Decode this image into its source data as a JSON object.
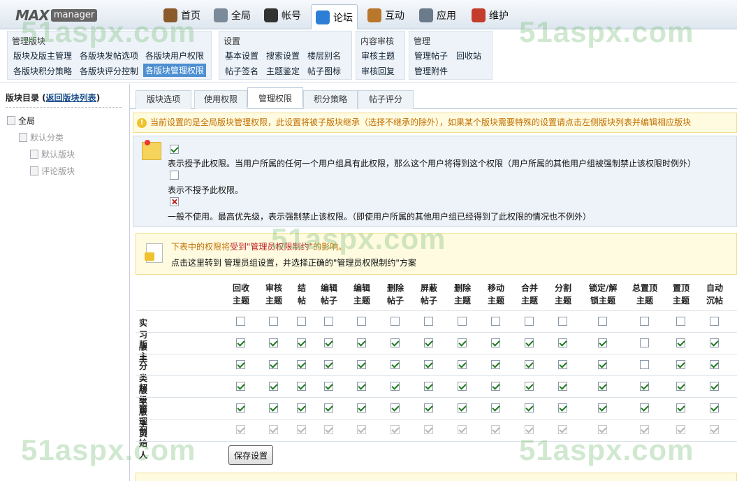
{
  "logo": {
    "max": "MAX",
    "manager": "manager"
  },
  "nav": [
    {
      "label": "首页",
      "icon": "home-icon",
      "color": "#8a5a2b"
    },
    {
      "label": "全局",
      "icon": "gear-icon",
      "color": "#7a8a99"
    },
    {
      "label": "帐号",
      "icon": "user-icon",
      "color": "#333333"
    },
    {
      "label": "论坛",
      "icon": "chat-icon",
      "color": "#2d7fd6"
    },
    {
      "label": "互动",
      "icon": "people-icon",
      "color": "#b9772c"
    },
    {
      "label": "应用",
      "icon": "app-icon",
      "color": "#6b7b8b"
    },
    {
      "label": "维护",
      "icon": "tools-icon",
      "color": "#c33c2c"
    }
  ],
  "submenu": {
    "g1": {
      "title": "管理版块",
      "items": [
        "版块及版主管理",
        "各版块发帖选项",
        "各版块用户权限",
        "各版块积分策略",
        "各版块评分控制",
        "各版块管理权限"
      ]
    },
    "g2": {
      "title": "设置",
      "items": [
        "基本设置",
        "搜索设置",
        "楼层别名",
        "帖子签名",
        "主题鉴定",
        "帖子图标"
      ]
    },
    "g3": {
      "title": "内容审核",
      "items": [
        "审核主题",
        "审核回复"
      ]
    },
    "g4": {
      "title": "管理",
      "items": [
        "管理帖子",
        "回收站",
        "管理附件"
      ]
    }
  },
  "sidebar": {
    "title": "版块目录 (",
    "link": "返回版块列表",
    "close": ")",
    "tree": [
      "全局",
      "默认分类",
      "默认版块",
      "评论版块"
    ]
  },
  "tabs": [
    "版块选项",
    "使用权限",
    "管理权限",
    "积分策略",
    "帖子评分"
  ],
  "warning": "当前设置的是全局版块管理权限，此设置将被子版块继承（选择不继承的除外），如果某个版块需要特殊的设置请点击左侧版块列表并编辑相应版块",
  "legend": {
    "granted": "表示授予此权限。当用户所属的任何一个用户组具有此权限，那么这个用户将得到这个权限（用户所属的其他用户组被强制禁止该权限时例外）",
    "notgranted": "表示不授予此权限。",
    "forbidden": "一般不使用。最高优先级，表示强制禁止该权限。（即使用户所属的其他用户组已经得到了此权限的情况也不例外）"
  },
  "info": {
    "l1a": "下表中的权限将",
    "l1b": "受到\"管理员权限制约\"",
    "l1c": "的影响。",
    "l2": "点击这里转到 管理员组设置，并选择正确的\"管理员权限制约\"方案"
  },
  "columns": [
    [
      "回收",
      "主题"
    ],
    [
      "审核",
      "主题"
    ],
    [
      "结",
      "帖"
    ],
    [
      "编辑",
      "帖子"
    ],
    [
      "编辑",
      "主题"
    ],
    [
      "删除",
      "帖子"
    ],
    [
      "屏蔽",
      "帖子"
    ],
    [
      "删除",
      "主题"
    ],
    [
      "移动",
      "主题"
    ],
    [
      "合并",
      "主题"
    ],
    [
      "分割",
      "主题"
    ],
    [
      "锁定/解",
      "锁主题"
    ],
    [
      "总置顶",
      "主题"
    ],
    [
      "置顶",
      "主题"
    ],
    [
      "自动",
      "沉帖"
    ]
  ],
  "rows": [
    {
      "label": "实习版主",
      "values": [
        0,
        0,
        0,
        0,
        0,
        0,
        0,
        0,
        0,
        0,
        0,
        0,
        0,
        0,
        0
      ],
      "disabled": false
    },
    {
      "label": "版主",
      "values": [
        1,
        1,
        1,
        1,
        1,
        1,
        1,
        1,
        1,
        1,
        1,
        1,
        0,
        1,
        1
      ],
      "disabled": false
    },
    {
      "label": "分类版主",
      "values": [
        1,
        1,
        1,
        1,
        1,
        1,
        1,
        1,
        1,
        1,
        1,
        1,
        0,
        1,
        1
      ],
      "disabled": false
    },
    {
      "label": "超级版主",
      "values": [
        1,
        1,
        1,
        1,
        1,
        1,
        1,
        1,
        1,
        1,
        1,
        1,
        1,
        1,
        1
      ],
      "disabled": false
    },
    {
      "label": "管理员",
      "values": [
        1,
        1,
        1,
        1,
        1,
        1,
        1,
        1,
        1,
        1,
        1,
        1,
        1,
        1,
        1
      ],
      "disabled": false
    },
    {
      "label": "创始人",
      "values": [
        1,
        1,
        1,
        1,
        1,
        1,
        1,
        1,
        1,
        1,
        1,
        1,
        1,
        1,
        1
      ],
      "disabled": true
    }
  ],
  "save": "保存设置",
  "watermark": "51aspx.com"
}
